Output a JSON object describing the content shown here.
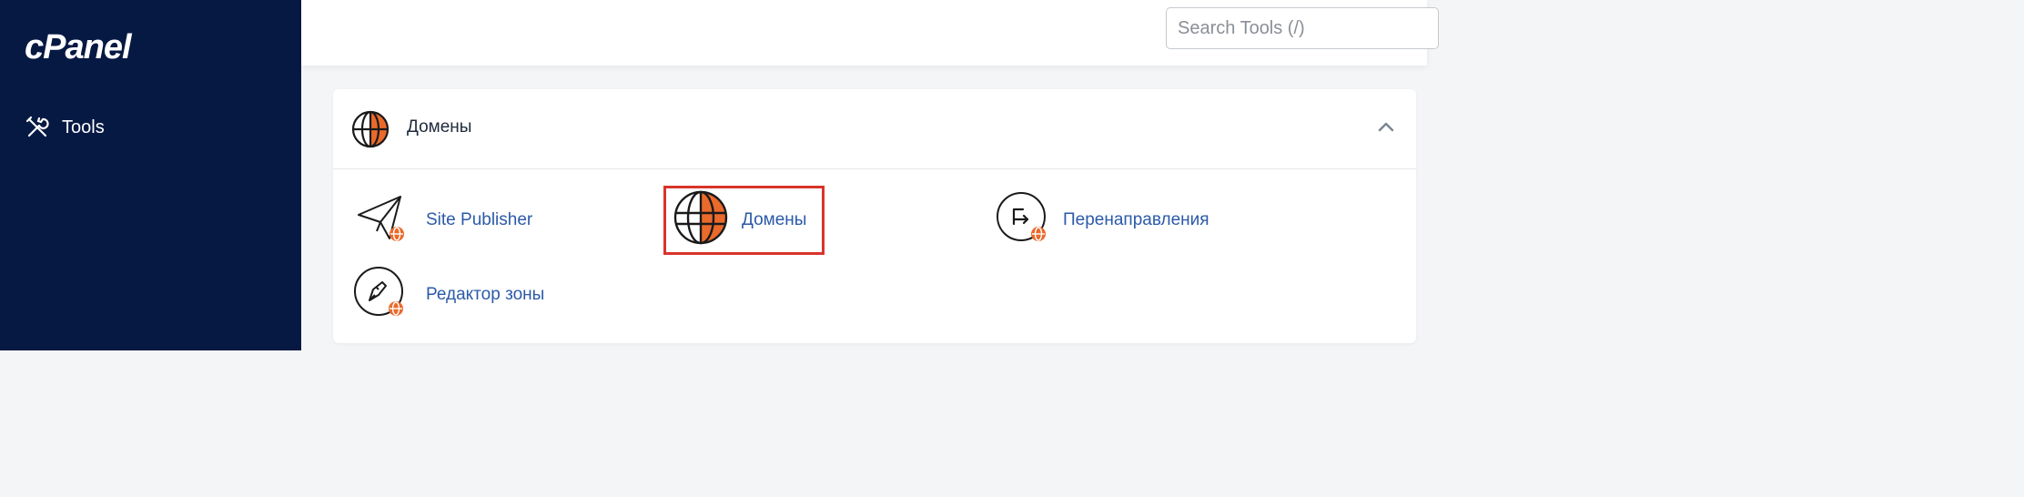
{
  "app": {
    "logo_text": "cPanel"
  },
  "sidebar": {
    "items": [
      {
        "label": "Tools",
        "icon": "tools-icon"
      }
    ]
  },
  "header": {
    "search_placeholder": "Search Tools (/)"
  },
  "panel": {
    "title": "Домены",
    "icon": "globe-icon",
    "expanded": true,
    "tools": [
      {
        "label": "Site Publisher",
        "icon": "paper-plane-globe-icon"
      },
      {
        "label": "Домены",
        "icon": "globe-icon",
        "highlighted": true
      },
      {
        "label": "Перенаправления",
        "icon": "redirect-globe-icon"
      },
      {
        "label": "Редактор зоны",
        "icon": "zone-editor-globe-icon"
      }
    ]
  },
  "colors": {
    "sidebar_bg": "#061943",
    "accent_orange": "#ea6a2b",
    "link_blue": "#2b5aa8",
    "highlight_red": "#d9342b"
  }
}
